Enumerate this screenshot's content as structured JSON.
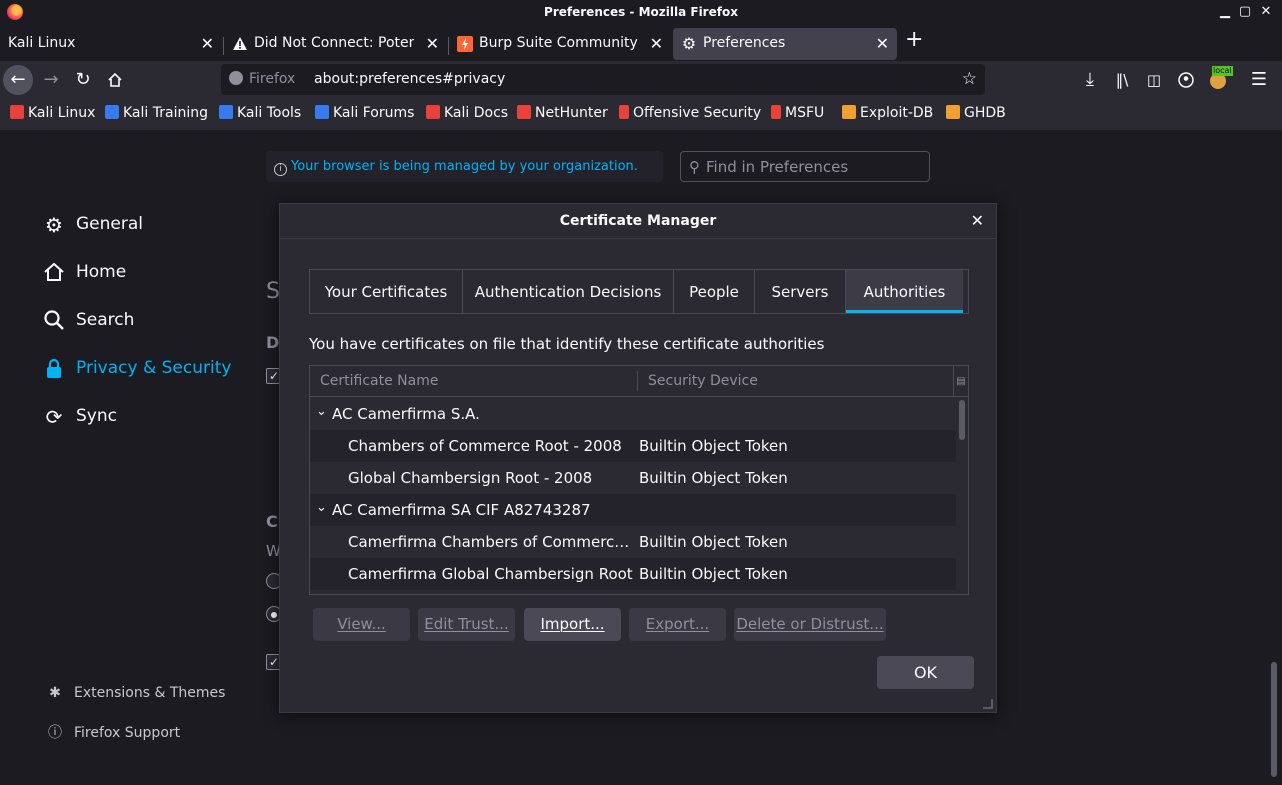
{
  "window": {
    "title": "Preferences - Mozilla Firefox"
  },
  "tabs": [
    {
      "label": "Kali Linux",
      "icon": "none"
    },
    {
      "label": "Did Not Connect: Potenti",
      "icon": "warning-icon"
    },
    {
      "label": "Burp Suite Community Ed",
      "icon": "burp-icon"
    },
    {
      "label": "Preferences",
      "icon": "gear-icon"
    }
  ],
  "navbar": {
    "identity": "Firefox",
    "url": "about:preferences#privacy"
  },
  "bookmarks": [
    {
      "label": "Kali Linux",
      "color": "#e8423b"
    },
    {
      "label": "Kali Training",
      "color": "#367bf0"
    },
    {
      "label": "Kali Tools",
      "color": "#367bf0"
    },
    {
      "label": "Kali Forums",
      "color": "#367bf0"
    },
    {
      "label": "Kali Docs",
      "color": "#e8423b"
    },
    {
      "label": "NetHunter",
      "color": "#e8423b"
    },
    {
      "label": "Offensive Security",
      "color": "#e8423b"
    },
    {
      "label": "MSFU",
      "color": "#e8423b"
    },
    {
      "label": "Exploit-DB",
      "color": "#f0a030"
    },
    {
      "label": "GHDB",
      "color": "#f0a030"
    }
  ],
  "prefs": {
    "managed_notice": "Your browser is being managed by your organization.",
    "find_placeholder": "Find in Preferences",
    "categories": [
      {
        "label": "General",
        "icon": "gear-icon"
      },
      {
        "label": "Home",
        "icon": "home-icon"
      },
      {
        "label": "Search",
        "icon": "search-icon"
      },
      {
        "label": "Privacy & Security",
        "icon": "lock-icon"
      },
      {
        "label": "Sync",
        "icon": "sync-icon"
      }
    ],
    "extensions_label": "Extensions & Themes",
    "support_label": "Firefox Support",
    "behind_s": "S",
    "behind_d": "D",
    "behind_c": "C",
    "behind_w": "W"
  },
  "dialog": {
    "title": "Certificate Manager",
    "tabs": [
      "Your Certificates",
      "Authentication Decisions",
      "People",
      "Servers",
      "Authorities"
    ],
    "active_tab": "Authorities",
    "description": "You have certificates on file that identify these certificate authorities",
    "columns": {
      "name": "Certificate Name",
      "device": "Security Device"
    },
    "rows": [
      {
        "name": "AC Camerfirma S.A.",
        "device": "",
        "group": true
      },
      {
        "name": "Chambers of Commerce Root - 2008",
        "device": "Builtin Object Token",
        "group": false
      },
      {
        "name": "Global Chambersign Root - 2008",
        "device": "Builtin Object Token",
        "group": false
      },
      {
        "name": "AC Camerfirma SA CIF A82743287",
        "device": "",
        "group": true
      },
      {
        "name": "Camerfirma Chambers of Commerce Ro...",
        "device": "Builtin Object Token",
        "group": false
      },
      {
        "name": "Camerfirma Global Chambersign Root",
        "device": "Builtin Object Token",
        "group": false
      }
    ],
    "buttons": {
      "view": "View...",
      "edit_trust": "Edit Trust...",
      "import": "Import...",
      "export": "Export...",
      "delete": "Delete or Distrust...",
      "ok": "OK"
    }
  }
}
